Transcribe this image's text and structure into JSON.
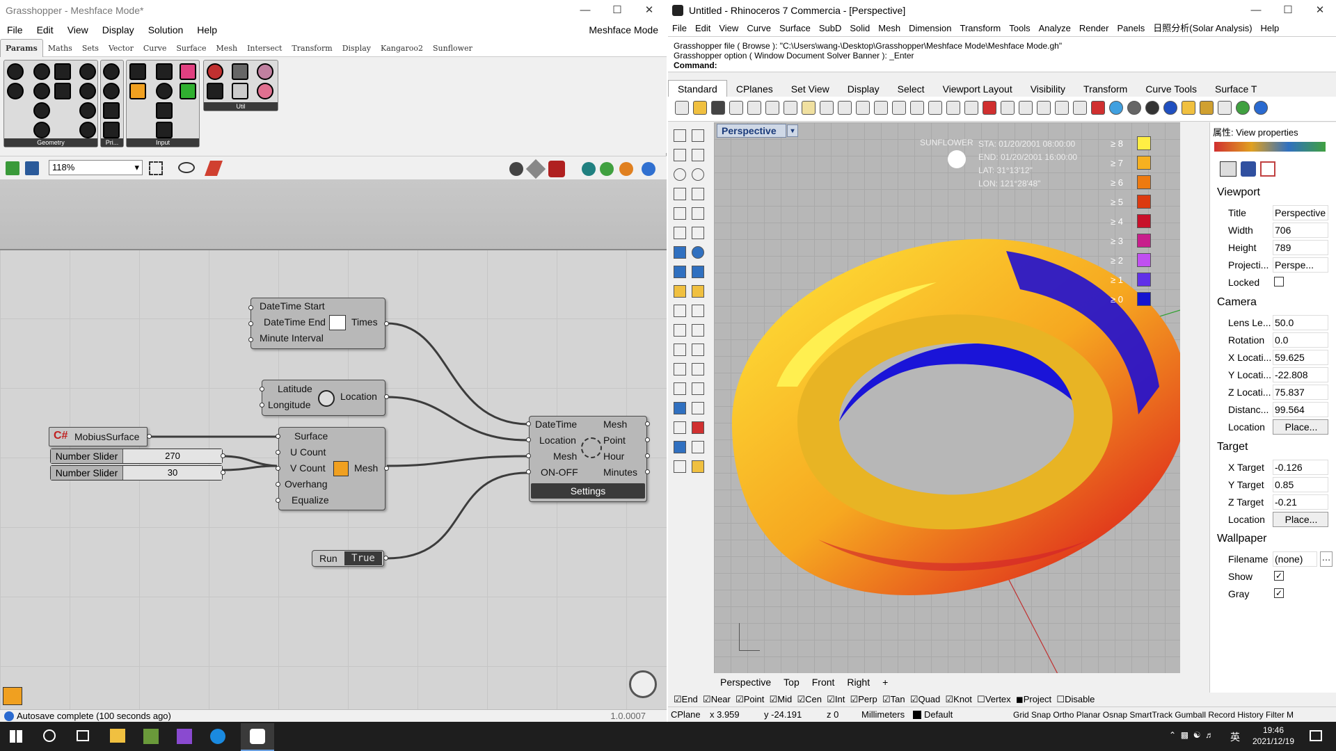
{
  "gh": {
    "title": "Grasshopper - Meshface Mode*",
    "menu": [
      "File",
      "Edit",
      "View",
      "Display",
      "Solution",
      "Help"
    ],
    "mode_label": "Meshface Mode",
    "tabs": [
      "Params",
      "Maths",
      "Sets",
      "Vector",
      "Curve",
      "Surface",
      "Mesh",
      "Intersect",
      "Transform",
      "Display",
      "Kangaroo2",
      "Sunflower"
    ],
    "groups": [
      "Geometry",
      "Pri...",
      "Input",
      "Util"
    ],
    "zoom": "118%",
    "components": {
      "times": {
        "inputs": [
          "DateTime Start",
          "DateTime End",
          "Minute Interval"
        ],
        "output": "Times"
      },
      "location": {
        "inputs": [
          "Latitude",
          "Longitude"
        ],
        "output": "Location"
      },
      "mobius": "MobiusSurface",
      "mesh": {
        "inputs": [
          "Surface",
          "U Count",
          "V Count",
          "Overhang",
          "Equalize"
        ],
        "output": "Mesh"
      },
      "sun": {
        "inputs": [
          "DateTime",
          "Location",
          "Mesh",
          "ON-OFF"
        ],
        "outputs": [
          "Mesh",
          "Point",
          "Hour",
          "Minutes"
        ],
        "button": "Settings"
      },
      "sliders": [
        {
          "label": "Number Slider",
          "value": "270"
        },
        {
          "label": "Number Slider",
          "value": "30"
        }
      ],
      "toggle": {
        "label": "Run",
        "value": "True"
      }
    },
    "status": "Autosave complete (100 seconds ago)",
    "version": "1.0.0007"
  },
  "rh": {
    "title": "Untitled - Rhinoceros 7 Commercia - [Perspective]",
    "menu": [
      "File",
      "Edit",
      "View",
      "Curve",
      "Surface",
      "SubD",
      "Solid",
      "Mesh",
      "Dimension",
      "Transform",
      "Tools",
      "Analyze",
      "Render",
      "Panels",
      "日照分析(Solar Analysis)",
      "Help"
    ],
    "cmd_lines": [
      "Grasshopper file ( Browse ): \"C:\\Users\\wang-\\Desktop\\Grasshopper\\Meshface Mode\\Meshface Mode.gh\"",
      "Grasshopper option ( Window  Document  Solver  Banner ): _Enter",
      "Command:"
    ],
    "tabs": [
      "Standard",
      "CPlanes",
      "Set View",
      "Display",
      "Select",
      "Viewport Layout",
      "Visibility",
      "Transform",
      "Curve Tools",
      "Surface T"
    ],
    "viewport": "Perspective",
    "overlay": {
      "brand": "SUNFLOWER",
      "sta": "STA: 01/20/2001 08:00:00",
      "end": "END: 01/20/2001 16:00:00",
      "lat": "LAT: 31°13'12\"",
      "lon": "LON: 121°28'48\""
    },
    "legend": [
      {
        "label": "≥ 8",
        "color": "#ffee44"
      },
      {
        "label": "≥ 7",
        "color": "#f6b020"
      },
      {
        "label": "≥ 6",
        "color": "#ee7a10"
      },
      {
        "label": "≥ 5",
        "color": "#dc3a10"
      },
      {
        "label": "≥ 4",
        "color": "#c8102a"
      },
      {
        "label": "≥ 3",
        "color": "#c81e8c"
      },
      {
        "label": "≥ 2",
        "color": "#c050f0"
      },
      {
        "label": "≥ 1",
        "color": "#6030e8"
      },
      {
        "label": "≥ 0",
        "color": "#1414d0"
      }
    ],
    "vp_tabs": [
      "Perspective",
      "Top",
      "Front",
      "Right"
    ],
    "props": {
      "header": "属性: View properties",
      "viewport": "Viewport",
      "title_k": "Title",
      "title_v": "Perspective",
      "width_k": "Width",
      "width_v": "706",
      "height_k": "Height",
      "height_v": "789",
      "proj_k": "Projecti...",
      "proj_v": "Perspe...",
      "locked_k": "Locked",
      "camera": "Camera",
      "lens_k": "Lens Le...",
      "lens_v": "50.0",
      "rot_k": "Rotation",
      "rot_v": "0.0",
      "xl_k": "X Locati...",
      "xl_v": "59.625",
      "yl_k": "Y Locati...",
      "yl_v": "-22.808",
      "zl_k": "Z Locati...",
      "zl_v": "75.837",
      "dist_k": "Distanc...",
      "dist_v": "99.564",
      "loc_k": "Location",
      "place": "Place...",
      "target": "Target",
      "xt_k": "X Target",
      "xt_v": "-0.126",
      "yt_k": "Y Target",
      "yt_v": "0.85",
      "zt_k": "Z Target",
      "zt_v": "-0.21",
      "wallpaper": "Wallpaper",
      "file_k": "Filename",
      "file_v": "(none)",
      "show_k": "Show",
      "gray_k": "Gray"
    },
    "osnap": [
      "End",
      "Near",
      "Point",
      "Mid",
      "Cen",
      "Int",
      "Perp",
      "Tan",
      "Quad",
      "Knot",
      "Vertex",
      "Project",
      "Disable"
    ],
    "status": {
      "cplane": "CPlane",
      "x": "x 3.959",
      "y": "y -24.191",
      "z": "z 0",
      "units": "Millimeters",
      "layer": "Default",
      "flags": "Grid Snap Ortho Planar Osnap SmartTrack Gumball Record History Filter M"
    }
  },
  "taskbar": {
    "time": "19:46",
    "date": "2021/12/19",
    "ime": "英"
  }
}
